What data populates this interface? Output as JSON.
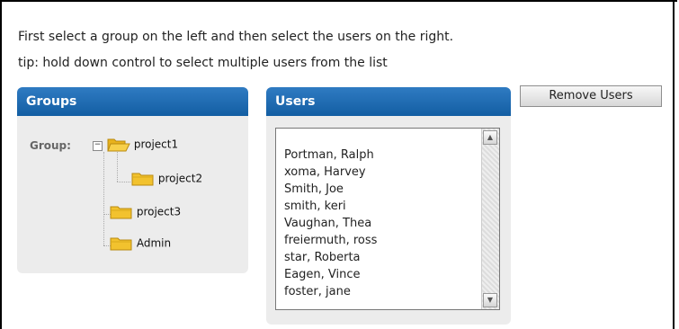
{
  "instructions": {
    "line1": "First select a group on the left and then select the users on the right.",
    "line2": "tip: hold down control to select multiple users from the list"
  },
  "groups_panel": {
    "title": "Groups",
    "group_label": "Group:",
    "tree": [
      {
        "label": "project1",
        "icon": "folder-open-icon",
        "expanded": true
      },
      {
        "label": "project2",
        "icon": "folder-icon"
      },
      {
        "label": "project3",
        "icon": "folder-icon"
      },
      {
        "label": "Admin",
        "icon": "folder-icon"
      }
    ]
  },
  "users_panel": {
    "title": "Users",
    "users": [
      "Portman, Ralph",
      "xoma, Harvey",
      "Smith, Joe",
      "smith, keri",
      "Vaughan, Thea",
      "freiermuth, ross",
      "star, Roberta",
      "Eagen, Vince",
      "foster, jane"
    ]
  },
  "toolbar": {
    "remove_users_label": "Remove Users"
  },
  "colors": {
    "panel_header": "#1a64aa",
    "panel_bg": "#ececec",
    "folder": "#f2c22e"
  }
}
